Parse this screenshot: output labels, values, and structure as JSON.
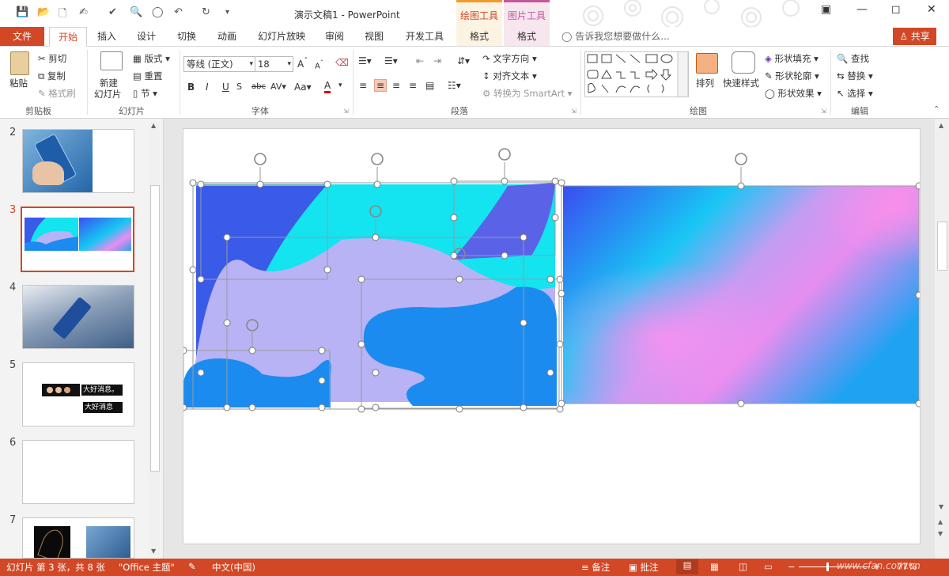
{
  "window": {
    "title": "演示文稿1 - PowerPoint",
    "context_tabs": [
      "绘图工具",
      "图片工具"
    ],
    "context_subtabs": [
      "格式",
      "格式"
    ]
  },
  "tabs": [
    "文件",
    "开始",
    "插入",
    "设计",
    "切换",
    "动画",
    "幻灯片放映",
    "审阅",
    "视图",
    "开发工具"
  ],
  "tell_me": "告诉我您想要做什么...",
  "share": "共享",
  "ribbon": {
    "clipboard": {
      "paste": "粘贴",
      "cut": "剪切",
      "copy": "复制",
      "format_painter": "格式刷",
      "label": "剪贴板"
    },
    "slides": {
      "new_slide_1": "新建",
      "new_slide_2": "幻灯片",
      "layout": "版式",
      "reset": "重置",
      "section": "节",
      "label": "幻灯片"
    },
    "font": {
      "font_name": "等线 (正文)",
      "font_size": "18",
      "bold": "B",
      "italic": "I",
      "underline": "U",
      "strike": "abc",
      "spacing": "AV",
      "case": "Aa",
      "color": "A",
      "label": "字体"
    },
    "paragraph": {
      "text_direction": "文字方向",
      "align_text": "对齐文本",
      "smartart": "转换为 SmartArt",
      "label": "段落"
    },
    "drawing": {
      "arrange": "排列",
      "quick_styles": "快速样式",
      "shape_fill": "形状填充",
      "shape_outline": "形状轮廓",
      "shape_effects": "形状效果",
      "label": "绘图"
    },
    "editing": {
      "find": "查找",
      "replace": "替换",
      "select": "选择",
      "label": "编辑"
    }
  },
  "slides": [
    {
      "number": "2"
    },
    {
      "number": "3"
    },
    {
      "number": "4"
    },
    {
      "number": "5",
      "text_1": "大好消息。",
      "text_2": "大好消息"
    },
    {
      "number": "6"
    },
    {
      "number": "7"
    }
  ],
  "status": {
    "slide_info": "幻灯片 第 3 张，共 8 张",
    "theme": "\"Office 主题\"",
    "language": "中文(中国)",
    "notes": "备注",
    "comments": "批注",
    "zoom": "77%",
    "watermark": "www.cfan.com.cn"
  },
  "colors": {
    "accent": "#d24726",
    "blue_dark": "#3a5ae8",
    "cyan": "#14e3f0",
    "lavender": "#b7b3f4",
    "blue": "#1c8bf0"
  }
}
